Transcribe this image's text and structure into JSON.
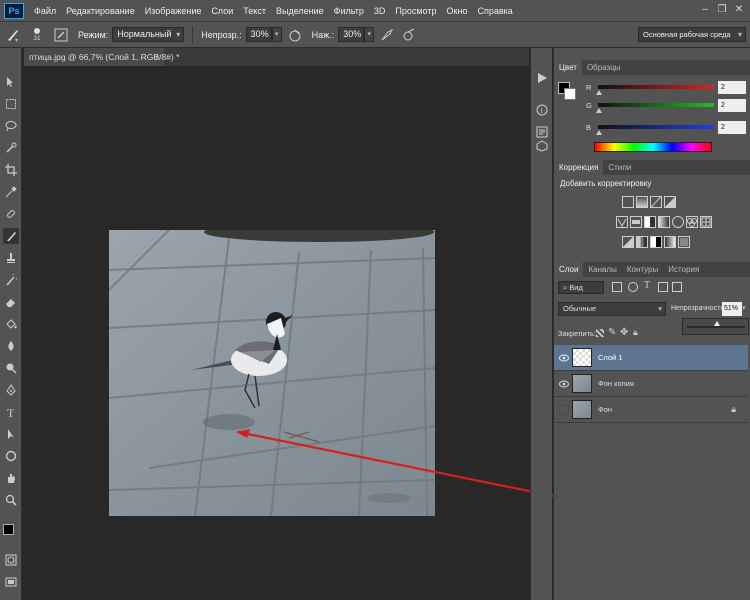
{
  "menubar": {
    "logo": "Ps",
    "items": [
      "Файл",
      "Редактирование",
      "Изображение",
      "Слои",
      "Текст",
      "Выделение",
      "Фильтр",
      "3D",
      "Просмотр",
      "Окно",
      "Справка"
    ]
  },
  "options": {
    "brush_size": "31",
    "mode_label": "Режим:",
    "mode_value": "Нормальный",
    "opacity_label": "Непрозр.:",
    "opacity_value": "30%",
    "flow_label": "Наж.:",
    "flow_value": "30%",
    "workspace": "Основная рабочая среда"
  },
  "document": {
    "tab_title": "птица.jpg @ 66,7% (Слой 1, RGB/8#) *",
    "close": "×"
  },
  "color_panel": {
    "tabs": [
      "Цвет",
      "Образцы"
    ],
    "sliders": [
      {
        "label": "R",
        "value": "2",
        "color": "#e02020"
      },
      {
        "label": "G",
        "value": "2",
        "color": "#20c020"
      },
      {
        "label": "B",
        "value": "2",
        "color": "#2040e0"
      }
    ]
  },
  "adjustments_panel": {
    "tabs": [
      "Коррекция",
      "Стили"
    ],
    "title": "Добавить корректировку"
  },
  "layers_panel": {
    "tabs": [
      "Слои",
      "Каналы",
      "Контуры",
      "История"
    ],
    "filter_kind": "Вид",
    "blend_mode": "Обычные",
    "opacity_label": "Непрозрачность:",
    "opacity_value": "51%",
    "opacity_fraction": 0.51,
    "lock_label": "Закрепить:",
    "layers": [
      {
        "name": "Слой 1",
        "selected": true,
        "visible": true
      },
      {
        "name": "Фон копия",
        "selected": false,
        "visible": true
      },
      {
        "name": "Фон",
        "selected": false,
        "visible": false,
        "locked": true
      }
    ]
  },
  "colors": {
    "accent_selected": "#5e7591",
    "arrow": "#d42020"
  }
}
